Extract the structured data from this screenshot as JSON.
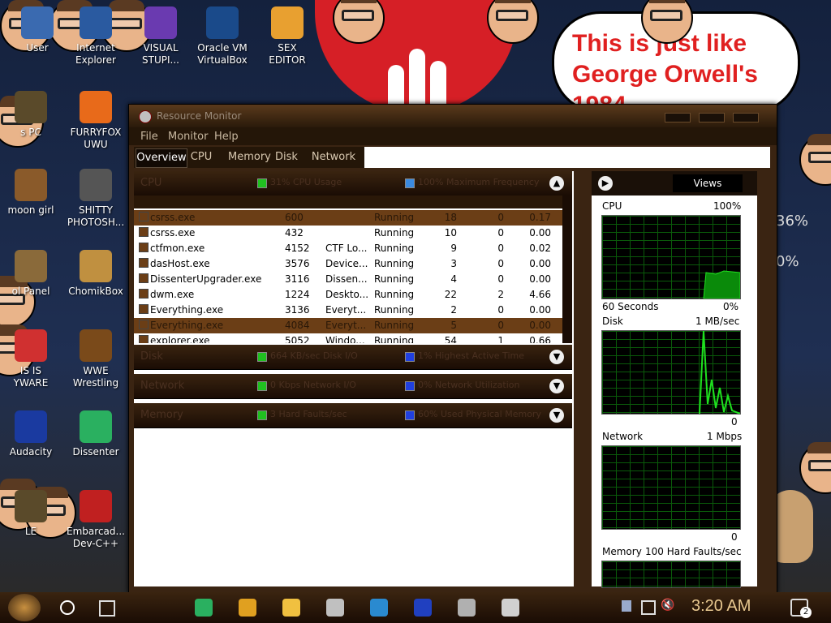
{
  "desktop": {
    "icons": [
      {
        "label": "User",
        "color": "#3a6ab0"
      },
      {
        "label": "Internet\nExplorer",
        "color": "#2a5aa0"
      },
      {
        "label": "VISUAL\nSTUPI...",
        "color": "#6a3ab0"
      },
      {
        "label": "Oracle VM\nVirtualBox",
        "color": "#1a4a8a"
      },
      {
        "label": "SEX\nEDITOR",
        "color": "#e8a030"
      },
      {
        "label": "s PC",
        "color": "#5a4a2a"
      },
      {
        "label": "FURRYFOX\nUWU",
        "color": "#e86a1a"
      },
      {
        "label": "moon girl",
        "color": "#8a5a2a"
      },
      {
        "label": "SHITTY\nPHOTOSH...",
        "color": "#555555"
      },
      {
        "label": "ol Panel",
        "color": "#8a6a3a"
      },
      {
        "label": "ChomikBox",
        "color": "#c09040"
      },
      {
        "label": "IS IS\nYWARE",
        "color": "#d03030"
      },
      {
        "label": "WWE\nWrestling",
        "color": "#7a4a1a"
      },
      {
        "label": "Audacity",
        "color": "#1a3aa0"
      },
      {
        "label": "Dissenter",
        "color": "#2ab060"
      },
      {
        "label": "LE",
        "color": "#5a4a2a"
      },
      {
        "label": "Embarcad...\nDev-C++",
        "color": "#c02020"
      }
    ],
    "speech_bubble": "This is just like\nGeorge Orwell's\n1984",
    "side_percent_1": "36%",
    "side_percent_2": "0%"
  },
  "window": {
    "title": "Resource Monitor",
    "menu": [
      "File",
      "Monitor",
      "Help"
    ],
    "tabs": [
      "Overview",
      "CPU",
      "Memory",
      "Disk",
      "Network"
    ],
    "sections": {
      "cpu": {
        "name": "CPU",
        "ind1": "31% CPU Usage",
        "ind2": "100% Maximum Frequency",
        "ind1_color": "#20c020",
        "ind2_color": "#3a8ae0"
      },
      "disk": {
        "name": "Disk",
        "ind1": "664 KB/sec Disk I/O",
        "ind2": "1% Highest Active Time",
        "ind1_color": "#20c020",
        "ind2_color": "#2040e0"
      },
      "network": {
        "name": "Network",
        "ind1": "0 Kbps Network I/O",
        "ind2": "0% Network Utilization",
        "ind1_color": "#20c020",
        "ind2_color": "#2040e0"
      },
      "memory": {
        "name": "Memory",
        "ind1": "3 Hard Faults/sec",
        "ind2": "60% Used Physical Memory",
        "ind1_color": "#20c020",
        "ind2_color": "#2040e0"
      }
    },
    "processes": [
      {
        "image": "csrss.exe",
        "pid": "600",
        "desc": "",
        "status": "Running",
        "threads": "18",
        "cpu": "0",
        "avg": "0.17",
        "selected": true
      },
      {
        "image": "csrss.exe",
        "pid": "432",
        "desc": "",
        "status": "Running",
        "threads": "10",
        "cpu": "0",
        "avg": "0.00"
      },
      {
        "image": "ctfmon.exe",
        "pid": "4152",
        "desc": "CTF Lo...",
        "status": "Running",
        "threads": "9",
        "cpu": "0",
        "avg": "0.02"
      },
      {
        "image": "dasHost.exe",
        "pid": "3576",
        "desc": "Device...",
        "status": "Running",
        "threads": "3",
        "cpu": "0",
        "avg": "0.00"
      },
      {
        "image": "DissenterUpgrader.exe",
        "pid": "3116",
        "desc": "Dissen...",
        "status": "Running",
        "threads": "4",
        "cpu": "0",
        "avg": "0.00"
      },
      {
        "image": "dwm.exe",
        "pid": "1224",
        "desc": "Deskto...",
        "status": "Running",
        "threads": "22",
        "cpu": "2",
        "avg": "4.66"
      },
      {
        "image": "Everything.exe",
        "pid": "3136",
        "desc": "Everyt...",
        "status": "Running",
        "threads": "2",
        "cpu": "0",
        "avg": "0.00"
      },
      {
        "image": "Everything.exe",
        "pid": "4084",
        "desc": "Everyt...",
        "status": "Running",
        "threads": "5",
        "cpu": "0",
        "avg": "0.00",
        "selected": true
      },
      {
        "image": "explorer.exe",
        "pid": "5052",
        "desc": "Windo...",
        "status": "Running",
        "threads": "54",
        "cpu": "1",
        "avg": "0.66"
      }
    ],
    "right": {
      "views_label": "Views",
      "cpu_label": "CPU",
      "cpu_max": "100%",
      "cpu_foot_left": "60 Seconds",
      "cpu_foot_right": "0%",
      "disk_label": "Disk",
      "disk_max": "1 MB/sec",
      "disk_foot": "0",
      "net_label": "Network",
      "net_max": "1 Mbps",
      "net_foot": "0",
      "mem_label": "Memory",
      "mem_max": "100 Hard Faults/sec"
    }
  },
  "taskbar": {
    "clock": "3:20 AM",
    "notifications": "2",
    "apps": [
      {
        "name": "dissenter",
        "color": "#2ab060"
      },
      {
        "name": "chrome",
        "color": "#e0a020"
      },
      {
        "name": "file-explorer",
        "color": "#f0c040"
      },
      {
        "name": "paint",
        "color": "#c0c0c0"
      },
      {
        "name": "edge",
        "color": "#2a8ad0"
      },
      {
        "name": "audacity",
        "color": "#2040c0"
      },
      {
        "name": "photoshop",
        "color": "#b0b0b0"
      },
      {
        "name": "resource-monitor",
        "color": "#d0d0d0"
      }
    ]
  }
}
